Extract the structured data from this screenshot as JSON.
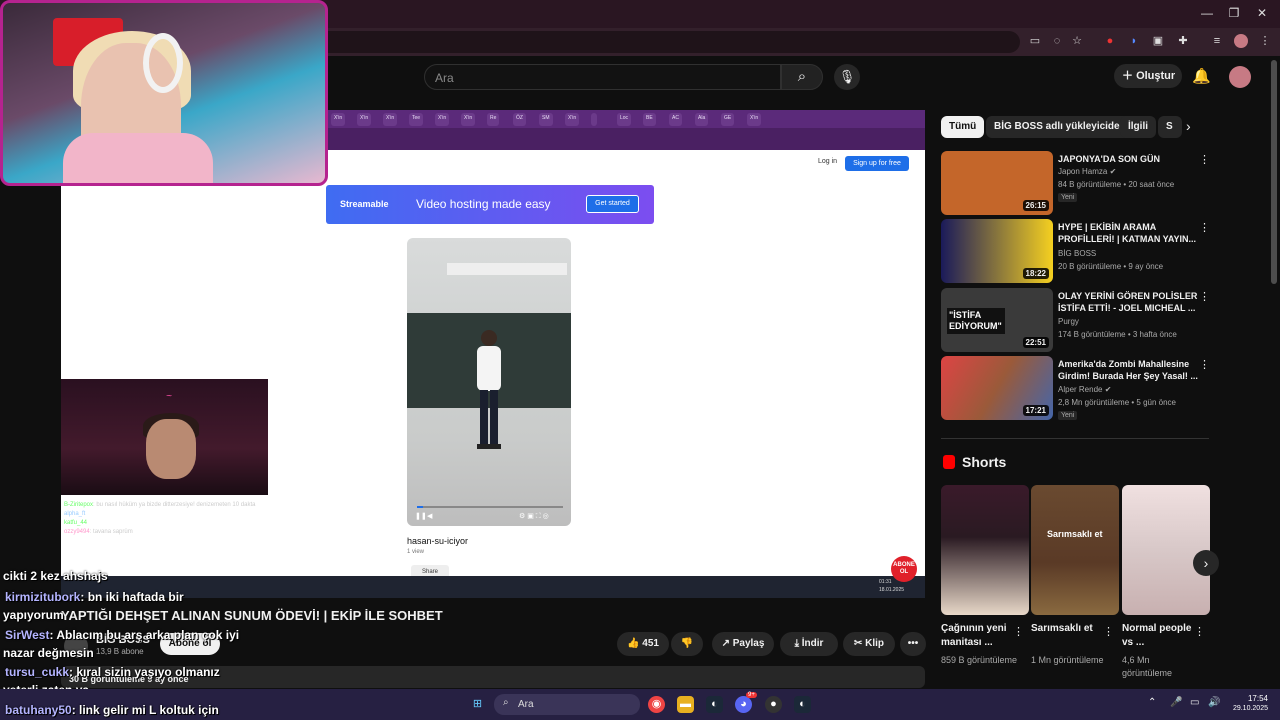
{
  "browser": {
    "window_minimize": "—",
    "window_maximize": "❐",
    "window_close": "✕"
  },
  "header": {
    "search_placeholder": "Ara",
    "create_label": "Oluştur"
  },
  "player": {
    "inner_tabs": [
      "X'in",
      "X'in",
      "X'in",
      "Tee",
      "X'in",
      "X'in",
      "Re",
      "ÖZ",
      "SM",
      "X'in",
      "",
      "Loc",
      "BE",
      "AC",
      "Ala",
      "GE",
      "X'in"
    ],
    "login_label": "Log in",
    "signup_label": "Sign up for free",
    "banner_brand": "Streamable",
    "banner_text": "Video hosting made easy",
    "banner_cta": "Get started",
    "video_name": "hasan-su-iciyor",
    "video_views": "1 view",
    "share_label": "Share",
    "inner_clock_time": "01:31",
    "inner_clock_date": "18.01.2025",
    "abone_sticker": "ABONE OL",
    "progress_fraction": 0.04
  },
  "overlay_chat_small": [
    {
      "user": "B-Ziritepox",
      "text": ": bu nasıl hüküm ya bizde ditterzesiye! denizemeten 10 dakta"
    },
    {
      "user": "alpha_ft",
      "text": ""
    },
    {
      "user": "katfu_44",
      "text": ""
    },
    {
      "user": "ozzy9494",
      "text": ": tavana saprüm"
    }
  ],
  "overlay_chat": [
    {
      "user": "",
      "text": "cikti 2 kez ahshajs"
    },
    {
      "user": "kirmizitubork",
      "text": ": bn iki haftada bir"
    },
    {
      "user": "",
      "text": "yapıyorum"
    },
    {
      "user": "SirWest",
      "text": ": Ablacım bu arş arka plan çok iyi"
    },
    {
      "user": "",
      "text": "nazar değmesin"
    },
    {
      "user": "tursu_cukk",
      "text": ": kıral sizin yaşıyo olmanız"
    },
    {
      "user": "",
      "text": "yeterli zaten ya"
    },
    {
      "user": "batuhany50",
      "text": ": link gelir mi L koltuk için"
    }
  ],
  "video": {
    "title": "YAPTIĞI DEHŞET ALINAN SUNUM ÖDEVİ! | EKİP İLE SOHBET",
    "channel": "BİG BOSS",
    "subscribers": "13,9 B abone",
    "subscribe_label": "Abone ol",
    "likes": "451",
    "share_label": "Paylaş",
    "download_label": "İndir",
    "clip_label": "Klip",
    "more_label": "•••",
    "views_age": "30 B görüntüleme  9 ay önce"
  },
  "sidebar": {
    "chips": [
      "Tümü",
      "BİG BOSS adlı yükleyiciden",
      "İlgili",
      "S"
    ],
    "recommendations": [
      {
        "title": "JAPONYA'DA SON GÜN",
        "channel": "Japon Hamza",
        "verified": true,
        "meta": "84 B görüntüleme • 20 saat önce",
        "badge": "Yeni",
        "duration": "26:15",
        "thumb_color": "#c4662a"
      },
      {
        "title": "HYPE | EKİBİN ARAMA PROFİLLERİ! | KATMAN YAYIN...",
        "channel": "BİG BOSS",
        "verified": false,
        "meta": "20 B görüntüleme • 9 ay önce",
        "badge": "",
        "duration": "18:22",
        "thumb_color": "#2a2a6a"
      },
      {
        "title": "OLAY YERİNİ GÖREN POLİSLER İSTİFA ETTİ! - JOEL MICHEAL ...",
        "channel": "Purgy",
        "verified": false,
        "meta": "174 B görüntüleme • 3 hafta önce",
        "badge": "",
        "duration": "22:51",
        "thumb_color": "#3a3a3a",
        "thumb_text": "\"İSTİFA EDİYORUM\""
      },
      {
        "title": "Amerika'da Zombi Mahallesine Girdim! Burada Her Şey Yasal! ...",
        "channel": "Alper Rende",
        "verified": true,
        "meta": "2,8 Mn görüntüleme • 5 gün önce",
        "badge": "Yeni",
        "duration": "17:21",
        "thumb_color": "#9a5a3a"
      }
    ],
    "shorts_header": "Shorts",
    "shorts": [
      {
        "title": "Çağnının yeni manitası ...",
        "views": "859 B görüntüleme",
        "color": "#2a1a22",
        "overlay": ""
      },
      {
        "title": "Sarımsaklı et",
        "views": "1 Mn görüntüleme",
        "color": "#5a3a26",
        "overlay": "Sarımsaklı et"
      },
      {
        "title": "Normal people vs ...",
        "views": "4,6 Mn görüntüleme",
        "color": "#d8c8c8",
        "overlay": ""
      }
    ]
  },
  "taskbar": {
    "search_label": "Ara",
    "time": "17:54",
    "date": "29.10.2025",
    "discord_badge": "9+"
  },
  "colors": {
    "accent_red": "#ff0000",
    "stream_border": "#b5238f",
    "streamable_blue": "#1e6ee8"
  }
}
